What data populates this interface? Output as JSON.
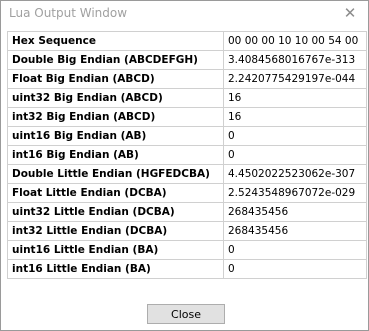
{
  "window": {
    "title": "Lua Output Window",
    "close_glyph": "✕"
  },
  "rows": [
    {
      "label": "Hex Sequence",
      "value": "00 00 00 10 10 00 54 00"
    },
    {
      "label": "Double Big Endian (ABCDEFGH)",
      "value": "3.4084568016767e-313"
    },
    {
      "label": "Float Big Endian (ABCD)",
      "value": "2.2420775429197e-044"
    },
    {
      "label": "uint32 Big Endian (ABCD)",
      "value": "16"
    },
    {
      "label": "int32 Big Endian (ABCD)",
      "value": "16"
    },
    {
      "label": "uint16 Big Endian (AB)",
      "value": "0"
    },
    {
      "label": "int16 Big Endian (AB)",
      "value": "0"
    },
    {
      "label": "Double Little Endian (HGFEDCBA)",
      "value": "4.4502022523062e-307"
    },
    {
      "label": "Float Little Endian (DCBA)",
      "value": "2.5243548967072e-029"
    },
    {
      "label": "uint32 Little Endian (DCBA)",
      "value": "268435456"
    },
    {
      "label": "int32 Little Endian (DCBA)",
      "value": "268435456"
    },
    {
      "label": "uint16 Little Endian (BA)",
      "value": "0"
    },
    {
      "label": "int16 Little Endian (BA)",
      "value": "0"
    }
  ],
  "footer": {
    "close_label": "Close"
  }
}
